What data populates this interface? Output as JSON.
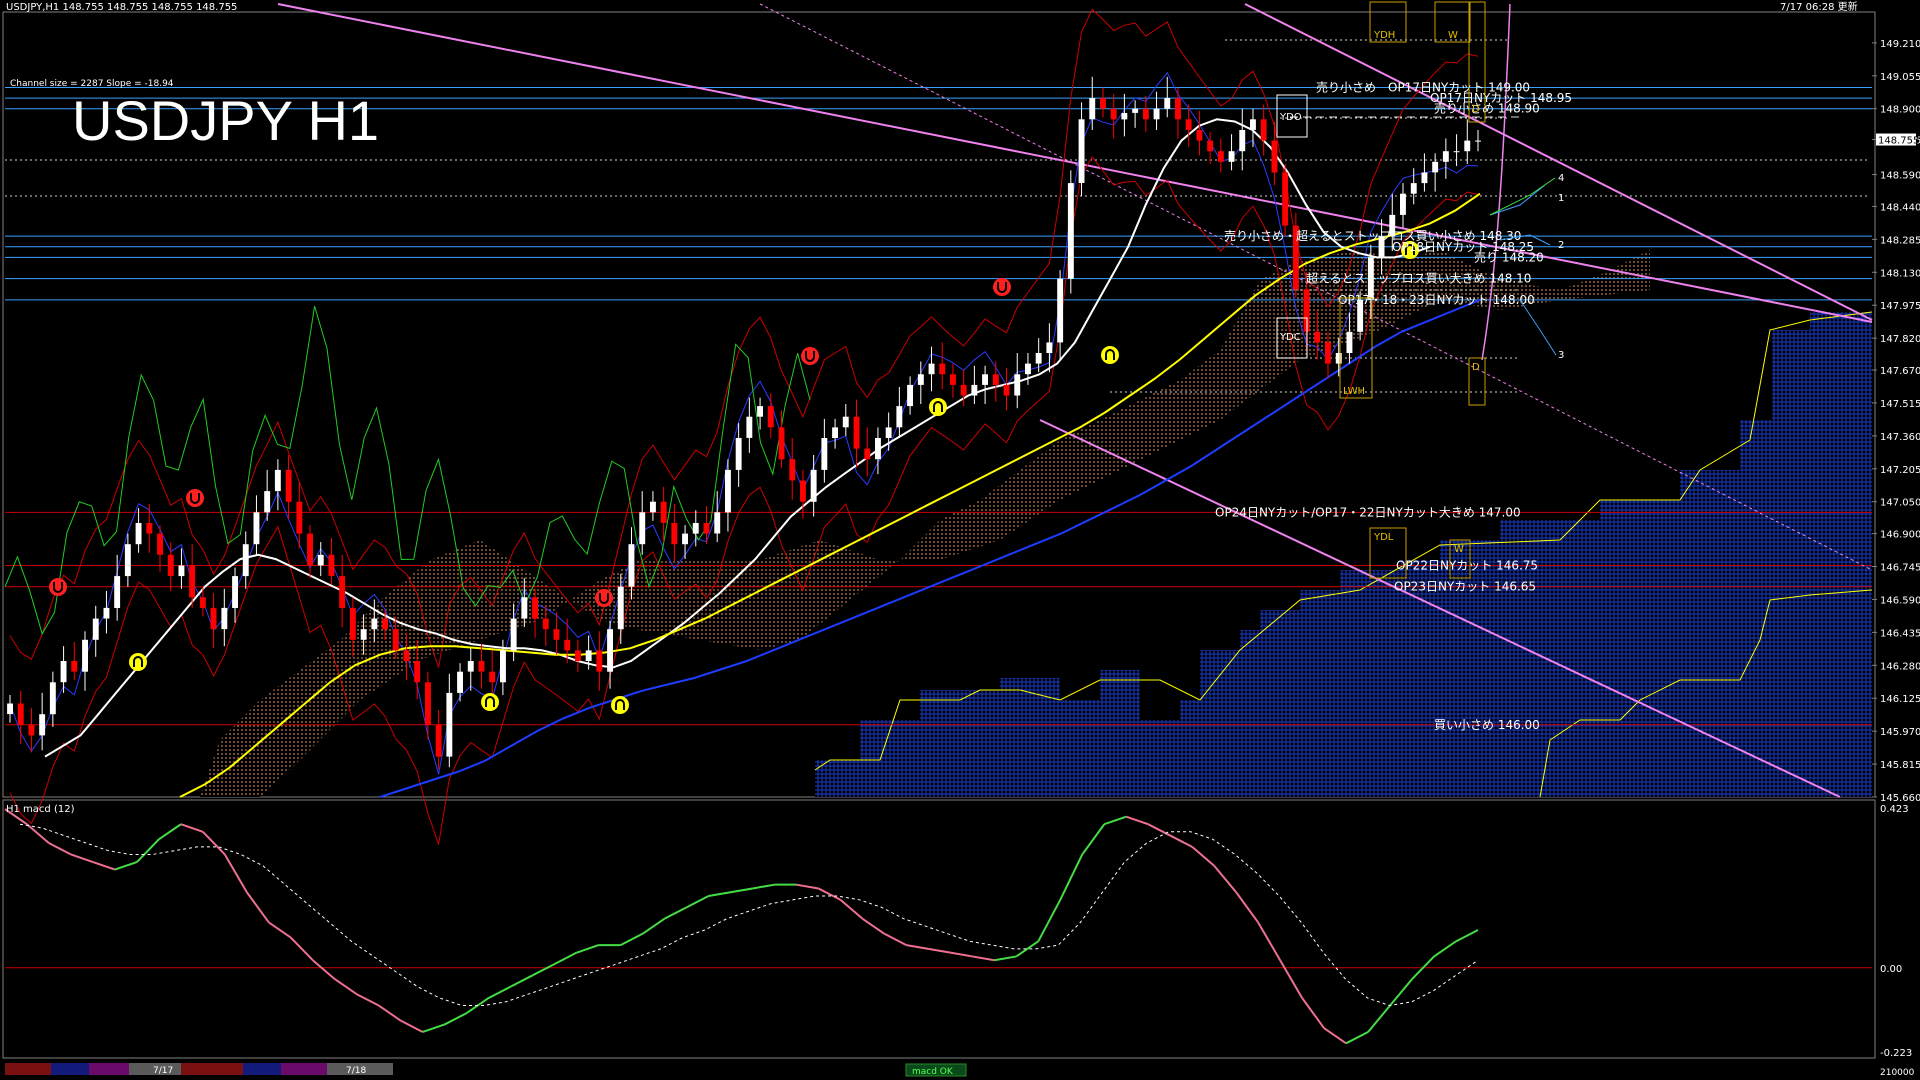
{
  "header": {
    "symbol_line": "USDJPY,H1  148.755 148.755 148.755 148.755",
    "updated": "7/17 06:28 更新",
    "channel_info": "Channel size = 2287 Slope = -18.94",
    "title": "USDJPY H1"
  },
  "sub": {
    "label": "H1  macd (12)",
    "ticks": [
      {
        "v": 0.423,
        "t": "0.423"
      },
      {
        "v": 0.0,
        "t": "0.00"
      },
      {
        "v": -0.223,
        "t": "-0.223"
      }
    ],
    "bottom_tick": "210000"
  },
  "bottom_bar": {
    "labels": [
      "7/17",
      "7/18"
    ],
    "tab": "macd OK"
  },
  "markers": {
    "ydh": "YDH",
    "ydo": "YDO",
    "ydc": "YDC",
    "ydl": "YDL",
    "lwh": "LWH",
    "w": "W",
    "d": "D",
    "n1": "1",
    "n2": "2",
    "n3": "3",
    "n4": "4"
  },
  "colors": {
    "bull": "#ffffff",
    "bear": "#ff0000",
    "ma_white": "#ffffff",
    "ma_yellow": "#ffff00",
    "ma_blue": "#1e3cff",
    "bb": "#cc0000",
    "chikou": "#22cc22",
    "channel": "#ee82ee",
    "cloud_blue": "#1030c0",
    "cloud_orange": "#d08040",
    "level_blue": "#3aa0ff",
    "level_red": "#cc0000",
    "macd_up": "#44dd44",
    "macd_down": "#ee7090"
  },
  "chart_data": {
    "type": "candlestick",
    "ylim": [
      145.66,
      149.28
    ],
    "y_ticks": [
      "149.210",
      "149.055",
      "148.900",
      "148.755",
      "148.590",
      "148.440",
      "148.285",
      "148.130",
      "147.975",
      "147.820",
      "147.670",
      "147.515",
      "147.360",
      "147.205",
      "147.050",
      "146.900",
      "146.745",
      "146.590",
      "146.435",
      "146.280",
      "146.125",
      "145.970",
      "145.815",
      "145.660"
    ],
    "current_price": "148.755",
    "levels": [
      {
        "price": 149.0,
        "label": "売り小さめ　OP17日NYカット 149.00",
        "kind": "blue"
      },
      {
        "price": 148.95,
        "label": "OP17日NYカット 148.95",
        "kind": "blue"
      },
      {
        "price": 148.9,
        "label": "売り小さめ 148.90",
        "kind": "blue"
      },
      {
        "price": 148.3,
        "label": "売り小さめ・超えるとストップロス買い小さめ 148.30",
        "kind": "blue"
      },
      {
        "price": 148.25,
        "label": "OP18日NYカット 148.25",
        "kind": "blue"
      },
      {
        "price": 148.2,
        "label": "売り 148.20",
        "kind": "blue"
      },
      {
        "price": 148.1,
        "label": "超えるとストップロス買い大きめ 148.10",
        "kind": "blue"
      },
      {
        "price": 148.0,
        "label": "OP17・18・23日NYカット 148.00",
        "kind": "blue"
      },
      {
        "price": 147.0,
        "label": "OP24日NYカット/OP17・22日NYカット大きめ 147.00",
        "kind": "red"
      },
      {
        "price": 146.75,
        "label": "OP22日NYカット 146.75",
        "kind": "red"
      },
      {
        "price": 146.65,
        "label": "OP23日NYカット 146.65",
        "kind": "red"
      },
      {
        "price": 146.0,
        "label": "買い小さめ 146.00",
        "kind": "red"
      }
    ],
    "close": [
      146.1,
      146.0,
      145.95,
      146.05,
      146.2,
      146.3,
      146.25,
      146.4,
      146.5,
      146.55,
      146.7,
      146.85,
      146.95,
      146.9,
      146.8,
      146.7,
      146.75,
      146.6,
      146.55,
      146.45,
      146.55,
      146.7,
      146.85,
      147.0,
      147.1,
      147.2,
      147.05,
      146.9,
      146.75,
      146.8,
      146.7,
      146.55,
      146.4,
      146.45,
      146.5,
      146.45,
      146.35,
      146.3,
      146.2,
      146.0,
      145.85,
      146.15,
      146.25,
      146.3,
      146.25,
      146.2,
      146.35,
      146.5,
      146.6,
      146.5,
      146.45,
      146.4,
      146.35,
      146.3,
      146.35,
      146.25,
      146.45,
      146.65,
      146.85,
      147.0,
      147.05,
      146.95,
      146.85,
      146.9,
      146.95,
      146.9,
      147.0,
      147.2,
      147.35,
      147.45,
      147.5,
      147.4,
      147.25,
      147.15,
      147.05,
      147.2,
      147.35,
      147.4,
      147.45,
      147.3,
      147.25,
      147.35,
      147.4,
      147.5,
      147.6,
      147.65,
      147.7,
      147.65,
      147.6,
      147.55,
      147.6,
      147.65,
      147.6,
      147.55,
      147.65,
      147.7,
      147.75,
      147.8,
      148.1,
      148.55,
      148.85,
      148.95,
      148.9,
      148.85,
      148.88,
      148.9,
      148.85,
      148.9,
      148.95,
      148.85,
      148.8,
      148.75,
      148.7,
      148.65,
      148.7,
      148.8,
      148.85,
      148.75,
      148.6,
      148.35,
      148.05,
      147.85,
      147.8,
      147.7,
      147.75,
      147.85,
      148.0,
      148.2,
      148.3,
      148.4,
      148.5,
      148.55,
      148.6,
      148.65,
      148.7,
      148.7,
      148.75,
      148.75
    ],
    "ma_white": [
      145.85,
      145.9,
      145.95,
      146.05,
      146.15,
      146.25,
      146.35,
      146.45,
      146.55,
      146.65,
      146.72,
      146.78,
      146.8,
      146.78,
      146.74,
      146.7,
      146.66,
      146.62,
      146.57,
      146.52,
      146.48,
      146.45,
      146.43,
      146.4,
      146.38,
      146.37,
      146.36,
      146.36,
      146.35,
      146.33,
      146.3,
      146.28,
      146.27,
      146.3,
      146.36,
      146.42,
      146.48,
      146.55,
      146.62,
      146.7,
      146.78,
      146.88,
      146.98,
      147.05,
      147.12,
      147.18,
      147.24,
      147.3,
      147.35,
      147.4,
      147.45,
      147.5,
      147.55,
      147.58,
      147.6,
      147.62,
      147.65,
      147.7,
      147.8,
      147.95,
      148.1,
      148.25,
      148.45,
      148.62,
      148.75,
      148.82,
      148.85,
      148.84,
      148.8,
      148.72,
      148.6,
      148.45,
      148.32,
      148.25,
      148.22,
      148.2,
      148.2,
      148.22,
      148.25
    ],
    "ma_yellow": [
      145.66,
      145.72,
      145.8,
      145.9,
      146.0,
      146.1,
      146.2,
      146.28,
      146.33,
      146.36,
      146.37,
      146.37,
      146.36,
      146.35,
      146.34,
      146.33,
      146.33,
      146.34,
      146.36,
      146.4,
      146.45,
      146.5,
      146.56,
      146.62,
      146.68,
      146.74,
      146.8,
      146.86,
      146.92,
      146.98,
      147.04,
      147.1,
      147.16,
      147.22,
      147.28,
      147.34,
      147.4,
      147.47,
      147.55,
      147.63,
      147.72,
      147.82,
      147.92,
      148.02,
      148.1,
      148.17,
      148.22,
      148.26,
      148.29,
      148.32,
      148.36,
      148.42,
      148.5
    ],
    "ma_blue": [
      145.66,
      145.7,
      145.74,
      145.78,
      145.83,
      145.9,
      145.97,
      146.03,
      146.08,
      146.12,
      146.16,
      146.19,
      146.22,
      146.26,
      146.3,
      146.35,
      146.4,
      146.45,
      146.5,
      146.55,
      146.6,
      146.65,
      146.7,
      146.75,
      146.8,
      146.85,
      146.9,
      146.96,
      147.02,
      147.08,
      147.15,
      147.22,
      147.3,
      147.38,
      147.46,
      147.54,
      147.62,
      147.7,
      147.78,
      147.85,
      147.9,
      147.95,
      148.0
    ],
    "macd": [
      0.42,
      0.38,
      0.33,
      0.3,
      0.28,
      0.26,
      0.28,
      0.34,
      0.38,
      0.36,
      0.3,
      0.2,
      0.12,
      0.08,
      0.02,
      -0.03,
      -0.07,
      -0.1,
      -0.14,
      -0.17,
      -0.15,
      -0.12,
      -0.08,
      -0.05,
      -0.02,
      0.01,
      0.04,
      0.06,
      0.06,
      0.09,
      0.13,
      0.16,
      0.19,
      0.2,
      0.21,
      0.22,
      0.22,
      0.21,
      0.18,
      0.13,
      0.09,
      0.06,
      0.05,
      0.04,
      0.03,
      0.02,
      0.03,
      0.07,
      0.18,
      0.3,
      0.38,
      0.4,
      0.38,
      0.35,
      0.32,
      0.27,
      0.2,
      0.12,
      0.02,
      -0.08,
      -0.16,
      -0.2,
      -0.17,
      -0.1,
      -0.03,
      0.03,
      0.07,
      0.1
    ],
    "signal": [
      0.38,
      0.37,
      0.35,
      0.33,
      0.31,
      0.3,
      0.3,
      0.31,
      0.32,
      0.32,
      0.3,
      0.27,
      0.22,
      0.17,
      0.12,
      0.07,
      0.03,
      -0.01,
      -0.05,
      -0.08,
      -0.1,
      -0.1,
      -0.09,
      -0.07,
      -0.05,
      -0.03,
      -0.01,
      0.01,
      0.03,
      0.05,
      0.08,
      0.1,
      0.13,
      0.15,
      0.17,
      0.18,
      0.19,
      0.19,
      0.18,
      0.16,
      0.13,
      0.11,
      0.09,
      0.07,
      0.06,
      0.05,
      0.05,
      0.06,
      0.12,
      0.2,
      0.28,
      0.33,
      0.36,
      0.36,
      0.34,
      0.3,
      0.25,
      0.19,
      0.12,
      0.04,
      -0.03,
      -0.08,
      -0.1,
      -0.09,
      -0.06,
      -0.02,
      0.02
    ]
  }
}
